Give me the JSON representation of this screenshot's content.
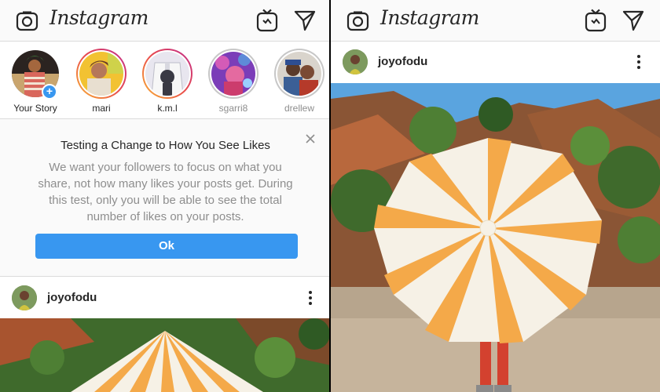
{
  "app": {
    "logo_text": "Instagram",
    "icons": [
      "camera-icon",
      "igtv-icon",
      "direct-message-icon"
    ]
  },
  "stories": [
    {
      "name": "Your Story",
      "ring": "none",
      "has_add": true
    },
    {
      "name": "mari",
      "ring": "unseen"
    },
    {
      "name": "k.m.l",
      "ring": "unseen"
    },
    {
      "name": "sgarri8",
      "ring": "seen"
    },
    {
      "name": "drellew",
      "ring": "seen"
    }
  ],
  "notice": {
    "title": "Testing a Change to How You See Likes",
    "body": "We want your followers to focus on what you share, not how many likes your posts get. During this test, only you will be able to see the total number of likes on your posts.",
    "button_label": "Ok",
    "close_icon": "close-icon"
  },
  "post": {
    "username": "joyofodu",
    "more_icon": "more-vertical-icon"
  },
  "colors": {
    "accent": "#3897f0",
    "story_ring_start": "#f9b433",
    "story_ring_end": "#c02d8f",
    "umbrella_stripe": "#f4a949"
  }
}
